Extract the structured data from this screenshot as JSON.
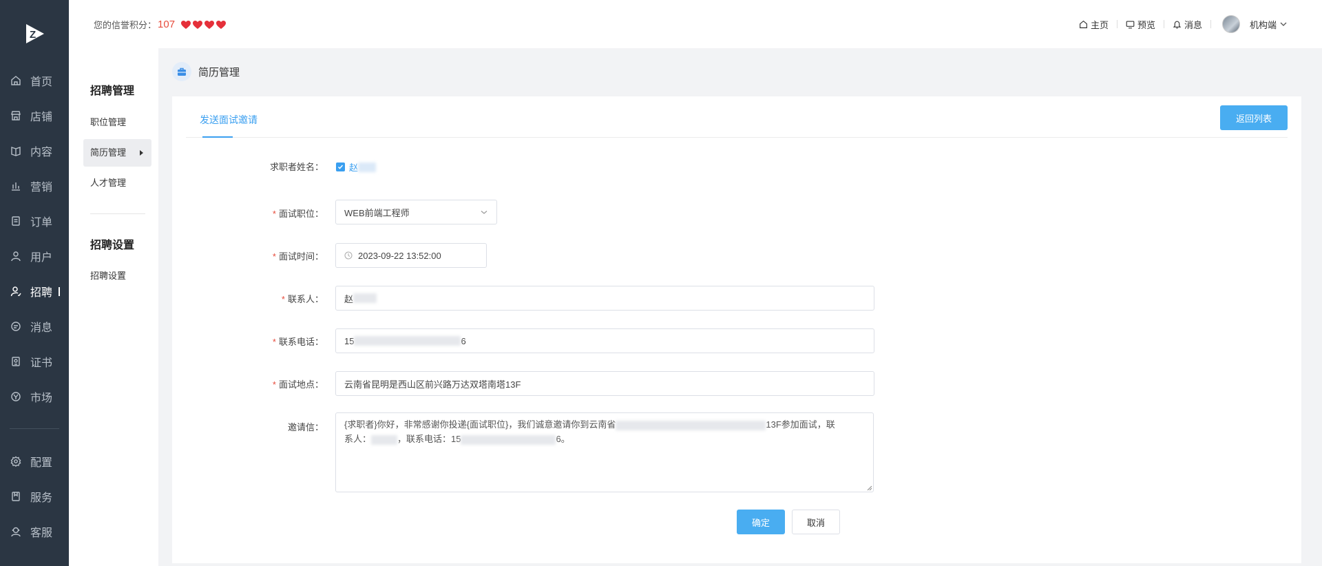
{
  "header": {
    "credit_label": "您的信誉积分：",
    "credit_score": "107",
    "links": {
      "home": "主页",
      "preview": "预览",
      "messages": "消息",
      "account": "机构端"
    }
  },
  "sidebar": {
    "items": [
      {
        "label": "首页",
        "icon": "home-icon"
      },
      {
        "label": "店铺",
        "icon": "store-icon"
      },
      {
        "label": "内容",
        "icon": "book-icon"
      },
      {
        "label": "营销",
        "icon": "bar-chart-icon"
      },
      {
        "label": "订单",
        "icon": "order-icon"
      },
      {
        "label": "用户",
        "icon": "user-icon"
      },
      {
        "label": "招聘",
        "icon": "recruit-icon"
      },
      {
        "label": "消息",
        "icon": "chat-icon"
      },
      {
        "label": "证书",
        "icon": "certificate-icon"
      },
      {
        "label": "市场",
        "icon": "market-icon"
      },
      {
        "label": "配置",
        "icon": "gear-icon"
      },
      {
        "label": "服务",
        "icon": "service-icon"
      },
      {
        "label": "客服",
        "icon": "headset-icon"
      }
    ],
    "active": "招聘"
  },
  "subnav": {
    "group1": "招聘管理",
    "items1": [
      "职位管理",
      "简历管理",
      "人才管理"
    ],
    "group2": "招聘设置",
    "items2": [
      "招聘设置"
    ]
  },
  "breadcrumb": "简历管理",
  "tab": "发送面试邀请",
  "back_button": "返回列表",
  "form": {
    "applicant_label": "求职者姓名：",
    "applicant_value": "赵",
    "position_label": "面试职位：",
    "position_value": "WEB前端工程师",
    "time_label": "面试时间：",
    "time_value": "2023-09-22 13:52:00",
    "contact_label": "联系人：",
    "contact_value": "赵",
    "phone_label": "联系电话：",
    "phone_prefix": "15",
    "phone_suffix": "6",
    "location_label": "面试地点：",
    "location_value": "云南省昆明是西山区前兴路万达双塔南塔13F",
    "letter_label": "邀请信：",
    "letter_part1": "{求职者}你好，非常感谢你投递{面试职位}，我们诚意邀请你到云南省",
    "letter_part2": "13F参加面试，联",
    "letter_part3": "系人：",
    "letter_part4": "，联系电话：15",
    "letter_part5": "6。"
  },
  "confirm_button": "确定",
  "cancel_button": "取消",
  "colors": {
    "accent": "#49adf1",
    "sidebar_bg": "#2b3643",
    "required": "#e74c3c"
  }
}
